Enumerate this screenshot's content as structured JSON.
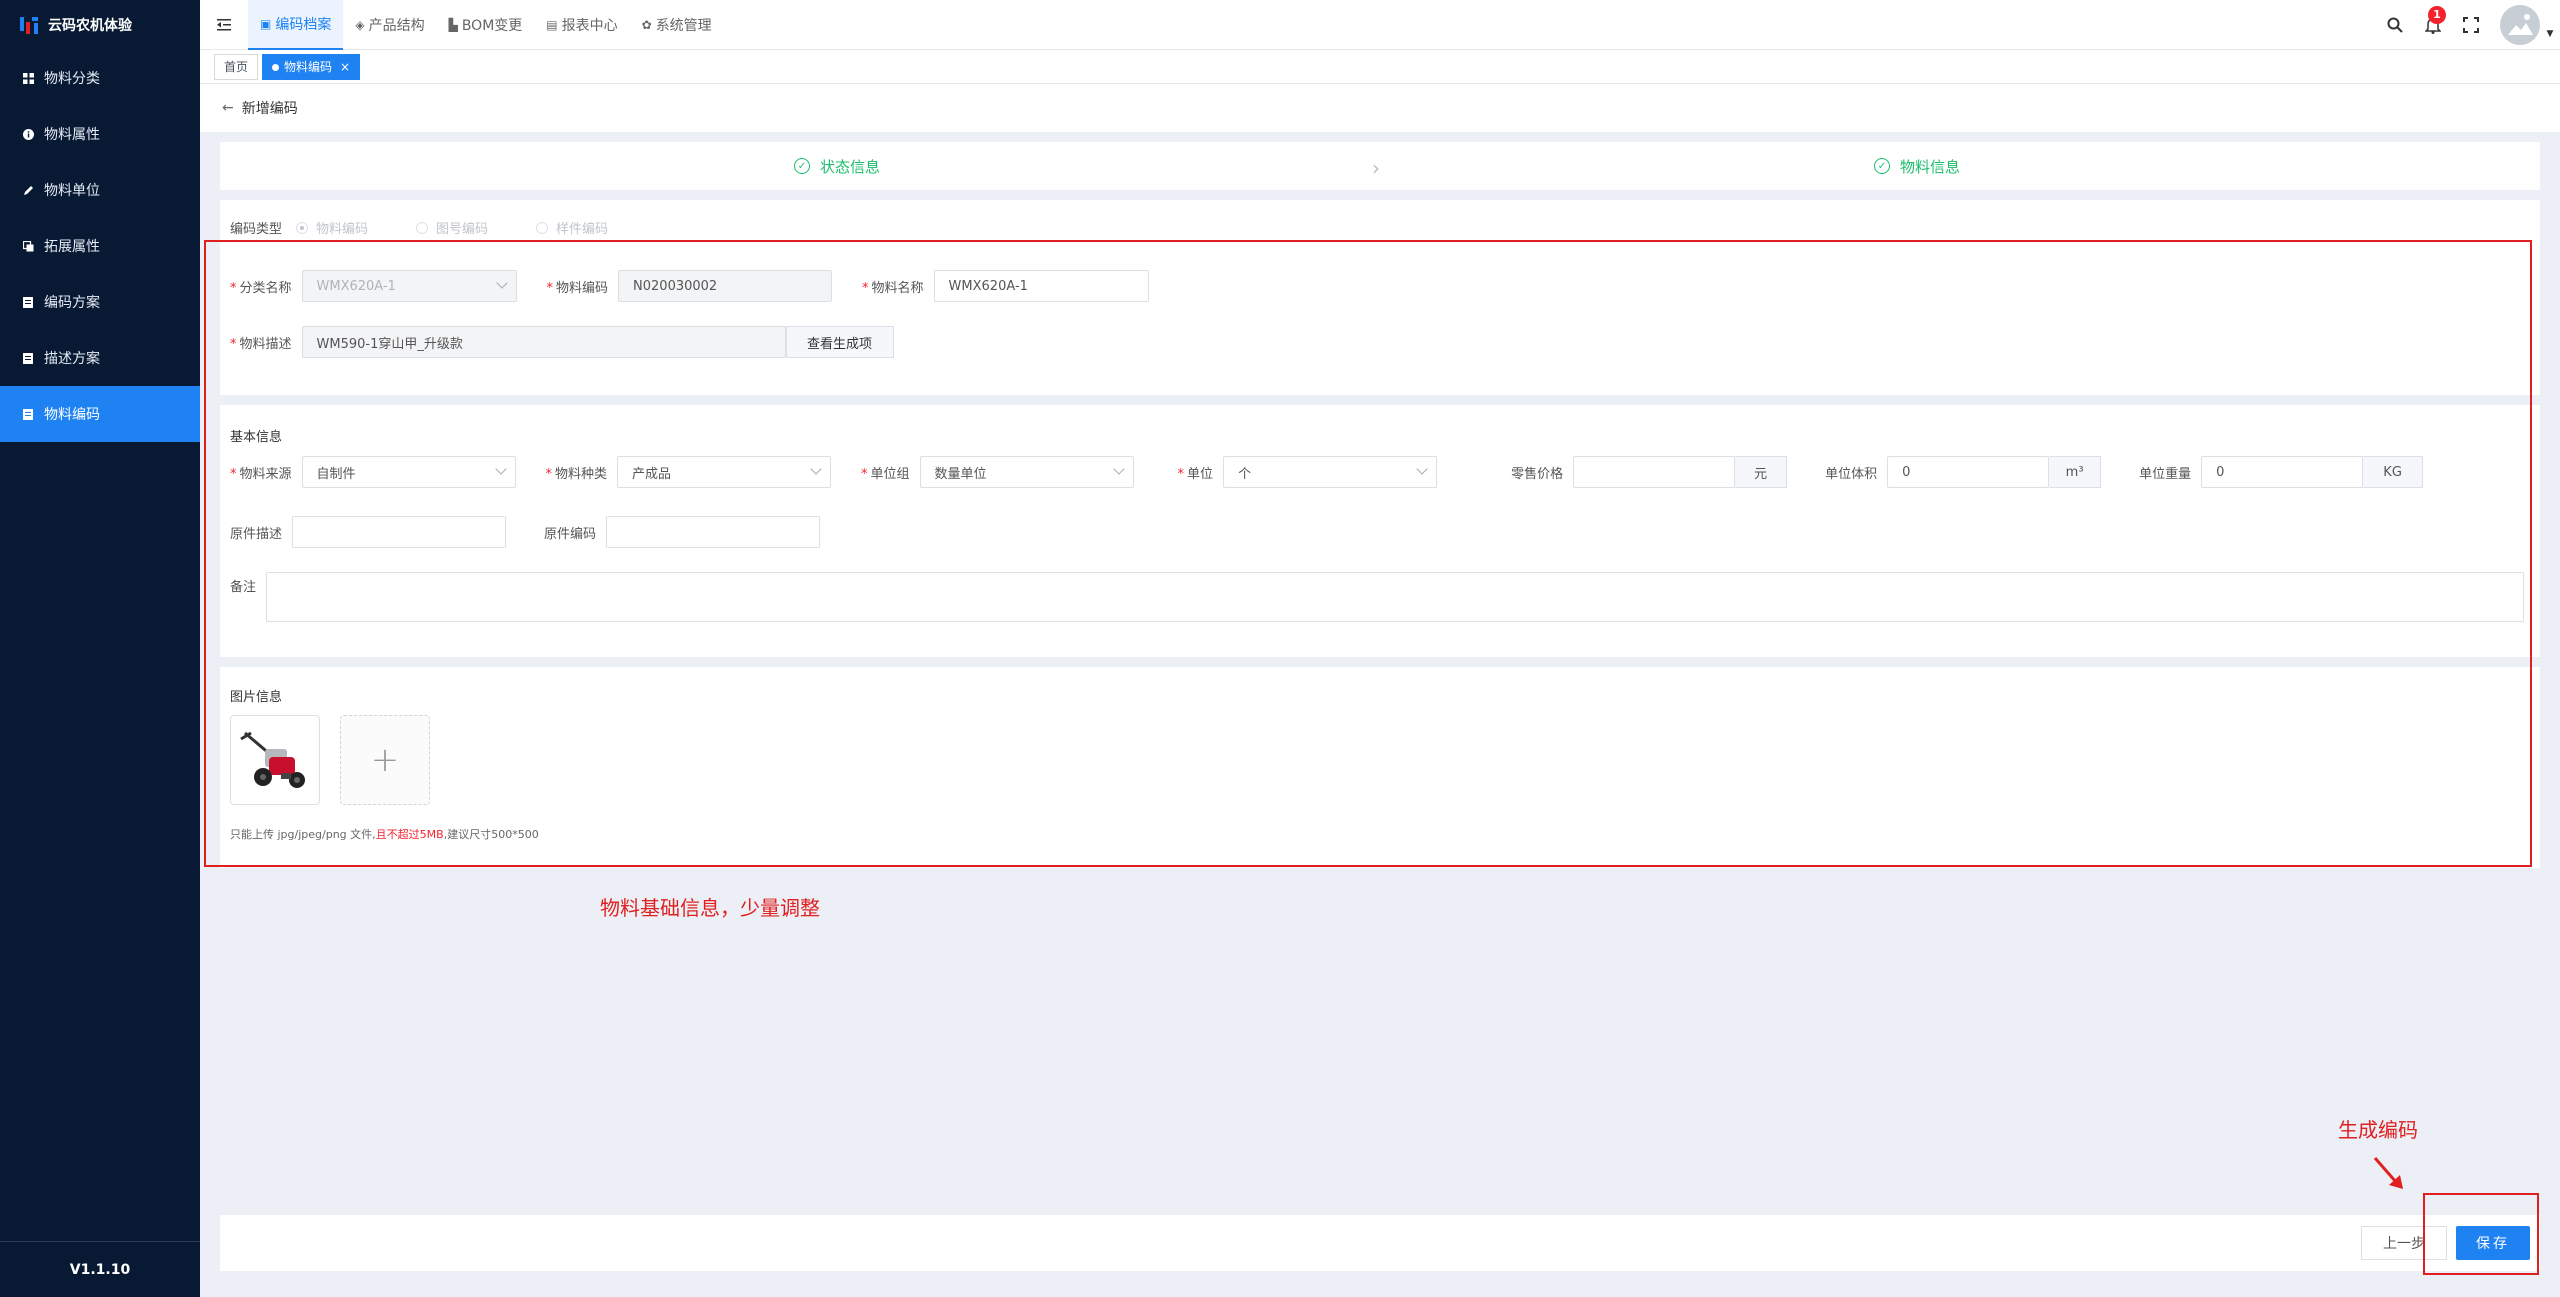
{
  "app": {
    "title": "云码农机体验",
    "version": "V1.1.10"
  },
  "sidebar": {
    "items": [
      {
        "label": "物料分类",
        "icon": "grid-icon"
      },
      {
        "label": "物料属性",
        "icon": "info-icon"
      },
      {
        "label": "物料单位",
        "icon": "pen-icon"
      },
      {
        "label": "拓展属性",
        "icon": "layers-icon"
      },
      {
        "label": "编码方案",
        "icon": "doc-icon"
      },
      {
        "label": "描述方案",
        "icon": "doc-icon"
      },
      {
        "label": "物料编码",
        "icon": "doc-icon",
        "active": true
      }
    ]
  },
  "topnav": {
    "tabs": [
      {
        "label": "编码档案",
        "active": true
      },
      {
        "label": "产品结构"
      },
      {
        "label": "BOM变更"
      },
      {
        "label": "报表中心"
      },
      {
        "label": "系统管理"
      }
    ],
    "notification_count": "1"
  },
  "tags": {
    "home": "首页",
    "current": "物料编码",
    "close": "×"
  },
  "page": {
    "title": "新增编码",
    "back": "←"
  },
  "steps": {
    "step1": "状态信息",
    "step2": "物料信息",
    "sep": "›"
  },
  "form": {
    "code_type_label": "编码类型",
    "code_type_options": [
      "物料编码",
      "图号编码",
      "样件编码"
    ],
    "category_label": "分类名称",
    "category_value": "WMX620A-1",
    "code_label": "物料编码",
    "code_value": "N020030002",
    "name_label": "物料名称",
    "name_value": "WMX620A-1",
    "desc_label": "物料描述",
    "desc_value": "WM590-1穿山甲_升级款",
    "view_btn": "查看生成项",
    "basic_title": "基本信息",
    "source_label": "物料来源",
    "source_value": "自制件",
    "kind_label": "物料种类",
    "kind_value": "产成品",
    "unit_group_label": "单位组",
    "unit_group_value": "数量单位",
    "unit_label": "单位",
    "unit_value": "个",
    "price_label": "零售价格",
    "price_value": "",
    "price_unit": "元",
    "volume_label": "单位体积",
    "volume_value": "0",
    "volume_unit": "m³",
    "weight_label": "单位重量",
    "weight_value": "0",
    "weight_unit": "KG",
    "orig_desc_label": "原件描述",
    "orig_code_label": "原件编码",
    "remark_label": "备注",
    "image_title": "图片信息",
    "upload_plus": "+",
    "hint_prefix": "只能上传 jpg/jpeg/png 文件,",
    "hint_warn": "且不超过5MB",
    "hint_suffix": ",建议尺寸500*500"
  },
  "annotations": {
    "main": "物料基础信息，少量调整",
    "gen": "生成编码"
  },
  "footer": {
    "prev": "上一步",
    "save": "保存"
  },
  "colors": {
    "primary": "#1f82f2",
    "sidebar": "#081a33",
    "success": "#19be6b",
    "annotation": "#e02020"
  }
}
